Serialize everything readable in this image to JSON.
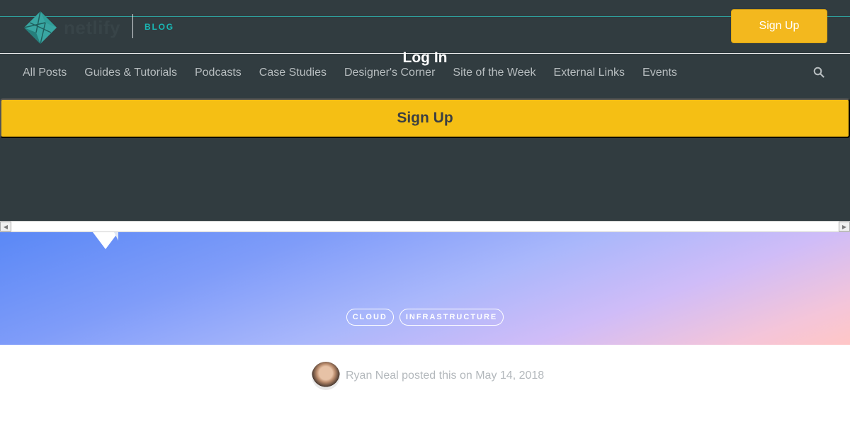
{
  "header": {
    "logo_text": "netlify",
    "blog_label": "BLOG",
    "signup_button": "Sign Up",
    "login_label": "Log In",
    "nav": [
      "All Posts",
      "Guides & Tutorials",
      "Podcasts",
      "Case Studies",
      "Designer's Corner",
      "Site of the Week",
      "External Links",
      "Events"
    ],
    "search_icon": "search-icon",
    "signup_bar": "Sign Up"
  },
  "hero": {
    "tags": [
      "CLOUD",
      "INFRASTRUCTURE"
    ]
  },
  "post": {
    "byline": "Ryan Neal posted this on May 14, 2018"
  },
  "colors": {
    "header_bg": "#313c40",
    "accent_yellow": "#f3b81e",
    "teal": "#19b6b3",
    "hero_gradient_start": "#5a88f6",
    "hero_gradient_end": "#ffc6c6"
  }
}
